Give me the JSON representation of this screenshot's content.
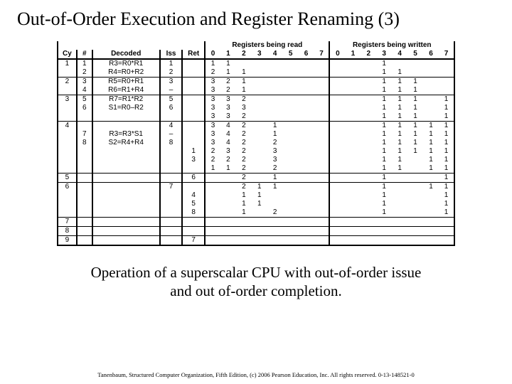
{
  "title": "Out-of-Order Execution and Register Renaming (3)",
  "caption_line1": "Operation of a superscalar CPU with out-of-order issue",
  "caption_line2": "and out of-order completion.",
  "credit": "Tanenbaum, Structured Computer Organization, Fifth Edition, (c) 2006 Pearson Education, Inc. All rights reserved. 0-13-148521-0",
  "headers": {
    "cy": "Cy",
    "num": "#",
    "decoded": "Decoded",
    "iss": "Iss",
    "ret": "Ret",
    "read_group": "Registers being read",
    "write_group": "Registers being written",
    "regs": [
      "0",
      "1",
      "2",
      "3",
      "4",
      "5",
      "6",
      "7"
    ]
  },
  "rows": [
    {
      "cy": "1",
      "num": "1",
      "dec": "R3=R0*R1",
      "iss": "1",
      "ret": "",
      "rd": [
        "1",
        "1",
        "",
        "",
        "",
        "",
        "",
        ""
      ],
      "wr": [
        "",
        "",
        "",
        "1",
        "",
        "",
        "",
        ""
      ],
      "end": false
    },
    {
      "cy": "",
      "num": "2",
      "dec": "R4=R0+R2",
      "iss": "2",
      "ret": "",
      "rd": [
        "2",
        "1",
        "1",
        "",
        "",
        "",
        "",
        ""
      ],
      "wr": [
        "",
        "",
        "",
        "1",
        "1",
        "",
        "",
        ""
      ],
      "end": true
    },
    {
      "cy": "2",
      "num": "3",
      "dec": "R5=R0+R1",
      "iss": "3",
      "ret": "",
      "rd": [
        "3",
        "2",
        "1",
        "",
        "",
        "",
        "",
        ""
      ],
      "wr": [
        "",
        "",
        "",
        "1",
        "1",
        "1",
        "",
        ""
      ],
      "end": false
    },
    {
      "cy": "",
      "num": "4",
      "dec": "R6=R1+R4",
      "iss": "–",
      "ret": "",
      "rd": [
        "3",
        "2",
        "1",
        "",
        "",
        "",
        "",
        ""
      ],
      "wr": [
        "",
        "",
        "",
        "1",
        "1",
        "1",
        "",
        ""
      ],
      "end": true
    },
    {
      "cy": "3",
      "num": "5",
      "dec": "R7=R1*R2",
      "iss": "5",
      "ret": "",
      "rd": [
        "3",
        "3",
        "2",
        "",
        "",
        "",
        "",
        ""
      ],
      "wr": [
        "",
        "",
        "",
        "1",
        "1",
        "1",
        "",
        "1"
      ],
      "end": false
    },
    {
      "cy": "",
      "num": "6",
      "dec": "S1=R0–R2",
      "iss": "6",
      "ret": "",
      "rd": [
        "3",
        "3",
        "3",
        "",
        "",
        "",
        "",
        ""
      ],
      "wr": [
        "",
        "",
        "",
        "1",
        "1",
        "1",
        "",
        "1"
      ],
      "end": false
    },
    {
      "cy": "",
      "num": "",
      "dec": "",
      "iss": "",
      "ret": "",
      "rd": [
        "3",
        "3",
        "2",
        "",
        "",
        "",
        "",
        ""
      ],
      "wr": [
        "",
        "",
        "",
        "1",
        "1",
        "1",
        "",
        "1"
      ],
      "end": true
    },
    {
      "cy": "4",
      "num": "",
      "dec": "",
      "iss": "4",
      "ret": "",
      "rd": [
        "3",
        "4",
        "2",
        "",
        "1",
        "",
        "",
        ""
      ],
      "wr": [
        "",
        "",
        "",
        "1",
        "1",
        "1",
        "1",
        "1"
      ],
      "end": false
    },
    {
      "cy": "",
      "num": "7",
      "dec": "R3=R3*S1",
      "iss": "–",
      "ret": "",
      "rd": [
        "3",
        "4",
        "2",
        "",
        "1",
        "",
        "",
        ""
      ],
      "wr": [
        "",
        "",
        "",
        "1",
        "1",
        "1",
        "1",
        "1"
      ],
      "end": false
    },
    {
      "cy": "",
      "num": "8",
      "dec": "S2=R4+R4",
      "iss": "8",
      "ret": "",
      "rd": [
        "3",
        "4",
        "2",
        "",
        "2",
        "",
        "",
        ""
      ],
      "wr": [
        "",
        "",
        "",
        "1",
        "1",
        "1",
        "1",
        "1"
      ],
      "end": false
    },
    {
      "cy": "",
      "num": "",
      "dec": "",
      "iss": "",
      "ret": "1",
      "rd": [
        "2",
        "3",
        "2",
        "",
        "3",
        "",
        "",
        ""
      ],
      "wr": [
        "",
        "",
        "",
        "1",
        "1",
        "1",
        "1",
        "1"
      ],
      "end": false
    },
    {
      "cy": "",
      "num": "",
      "dec": "",
      "iss": "",
      "ret": "3",
      "rd": [
        "2",
        "2",
        "2",
        "",
        "3",
        "",
        "",
        ""
      ],
      "wr": [
        "",
        "",
        "",
        "1",
        "1",
        "",
        "1",
        "1"
      ],
      "end": false
    },
    {
      "cy": "",
      "num": "",
      "dec": "",
      "iss": "",
      "ret": "",
      "rd": [
        "1",
        "1",
        "2",
        "",
        "2",
        "",
        "",
        ""
      ],
      "wr": [
        "",
        "",
        "",
        "1",
        "1",
        "",
        "1",
        "1"
      ],
      "end": true
    },
    {
      "cy": "5",
      "num": "",
      "dec": "",
      "iss": "",
      "ret": "6",
      "rd": [
        "",
        "",
        "2",
        "",
        "1",
        "",
        "",
        ""
      ],
      "wr": [
        "",
        "",
        "",
        "1",
        "",
        "",
        "",
        "1"
      ],
      "end": true
    },
    {
      "cy": "6",
      "num": "",
      "dec": "",
      "iss": "7",
      "ret": "",
      "rd": [
        "",
        "",
        "2",
        "1",
        "1",
        "",
        "",
        ""
      ],
      "wr": [
        "",
        "",
        "",
        "1",
        "",
        "",
        "1",
        "1"
      ],
      "end": false
    },
    {
      "cy": "",
      "num": "",
      "dec": "",
      "iss": "",
      "ret": "4",
      "rd": [
        "",
        "",
        "1",
        "1",
        "",
        "",
        "",
        ""
      ],
      "wr": [
        "",
        "",
        "",
        "1",
        "",
        "",
        "",
        "1"
      ],
      "end": false
    },
    {
      "cy": "",
      "num": "",
      "dec": "",
      "iss": "",
      "ret": "5",
      "rd": [
        "",
        "",
        "1",
        "1",
        "",
        "",
        "",
        ""
      ],
      "wr": [
        "",
        "",
        "",
        "1",
        "",
        "",
        "",
        "1"
      ],
      "end": false
    },
    {
      "cy": "",
      "num": "",
      "dec": "",
      "iss": "",
      "ret": "8",
      "rd": [
        "",
        "",
        "1",
        "",
        "2",
        "",
        "",
        ""
      ],
      "wr": [
        "",
        "",
        "",
        "1",
        "",
        "",
        "",
        "1"
      ],
      "end": true
    },
    {
      "cy": "7",
      "num": "",
      "dec": "",
      "iss": "",
      "ret": "",
      "rd": [
        "",
        "",
        "",
        "",
        "",
        "",
        "",
        ""
      ],
      "wr": [
        "",
        "",
        "",
        "",
        "",
        "",
        "",
        ""
      ],
      "end": true
    },
    {
      "cy": "8",
      "num": "",
      "dec": "",
      "iss": "",
      "ret": "",
      "rd": [
        "",
        "",
        "",
        "",
        "",
        "",
        "",
        ""
      ],
      "wr": [
        "",
        "",
        "",
        "",
        "",
        "",
        "",
        ""
      ],
      "end": true
    },
    {
      "cy": "9",
      "num": "",
      "dec": "",
      "iss": "",
      "ret": "7",
      "rd": [
        "",
        "",
        "",
        "",
        "",
        "",
        "",
        ""
      ],
      "wr": [
        "",
        "",
        "",
        "",
        "",
        "",
        "",
        ""
      ],
      "end": true
    }
  ]
}
